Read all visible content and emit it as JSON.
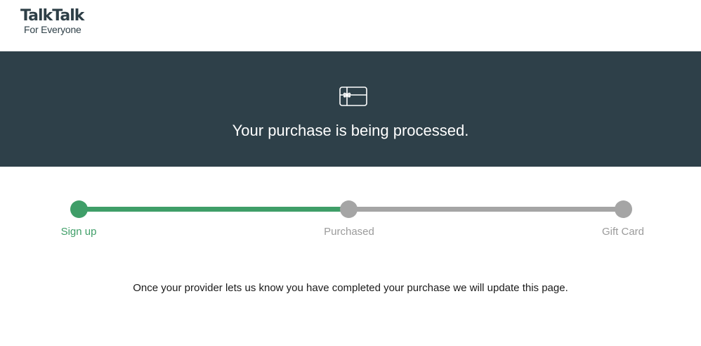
{
  "header": {
    "brand": "TalkTalk",
    "tagline": "For Everyone"
  },
  "banner": {
    "icon": "gift-card-icon",
    "title": "Your purchase is being processed."
  },
  "progress": {
    "steps": [
      {
        "label": "Sign up",
        "status": "complete"
      },
      {
        "label": "Purchased",
        "status": "pending"
      },
      {
        "label": "Gift Card",
        "status": "pending"
      }
    ]
  },
  "message": "Once your provider lets us know you have completed your purchase we will update this page.",
  "colors": {
    "brand_dark": "#2e4049",
    "progress_complete": "#3f9e68",
    "progress_pending": "#a5a5a5",
    "text_pending": "#9b9b9b"
  }
}
